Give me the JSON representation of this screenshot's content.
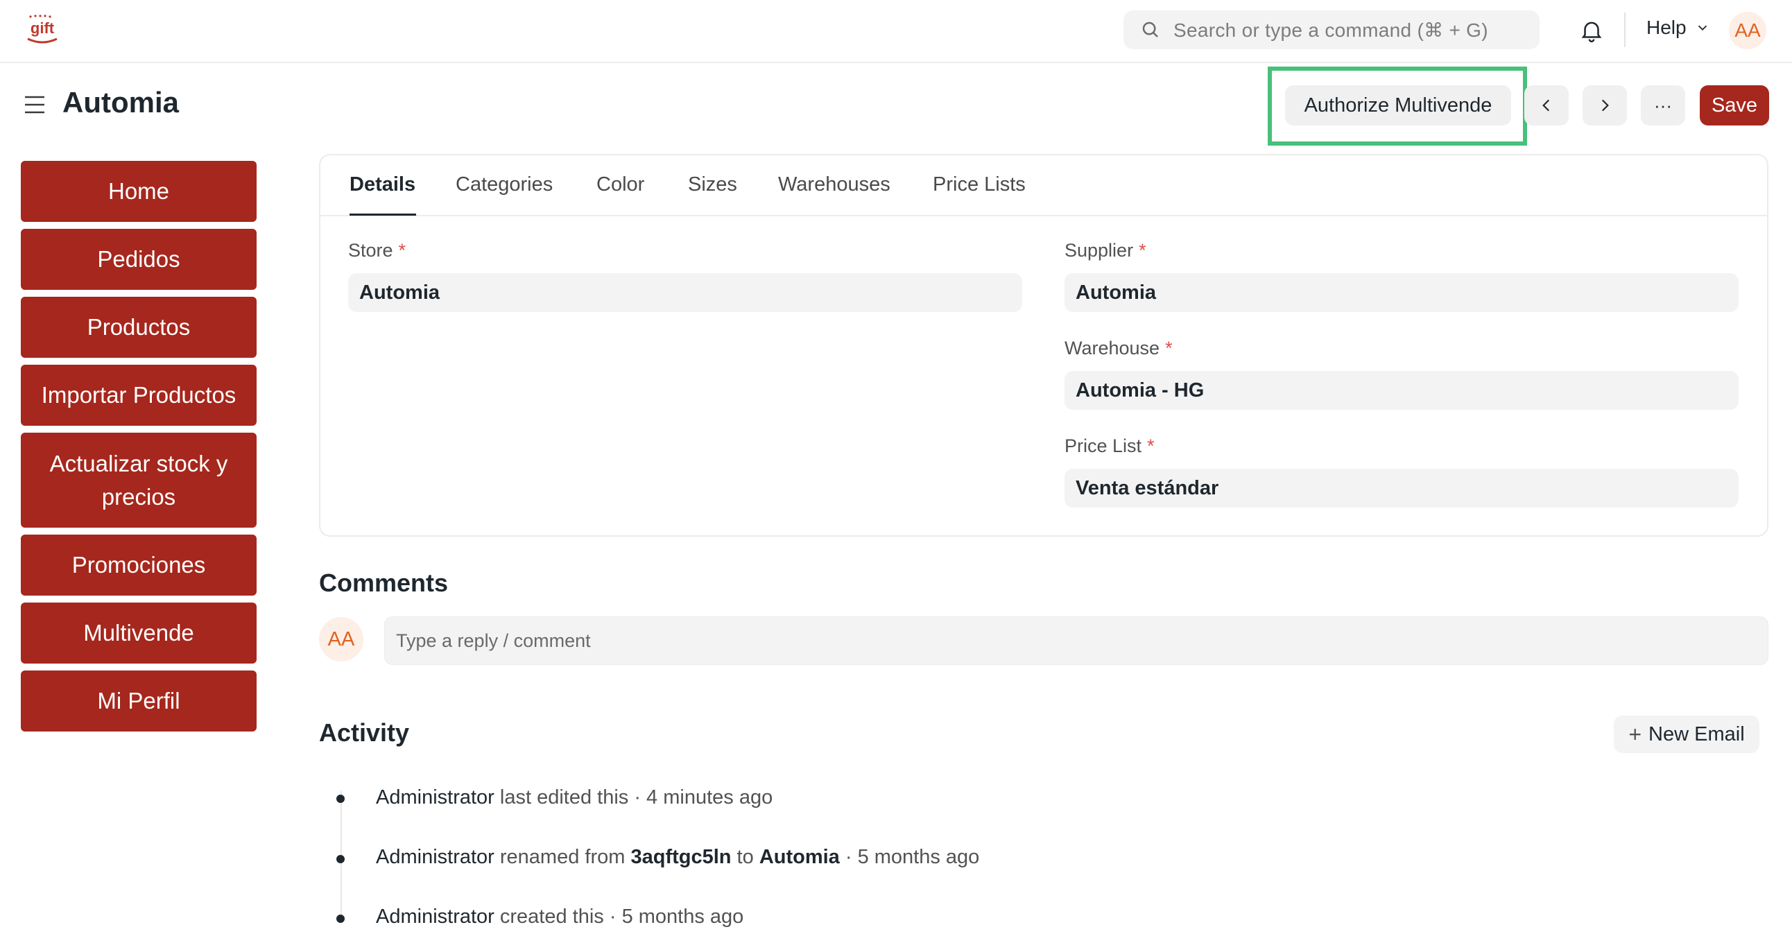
{
  "navbar": {
    "search_placeholder": "Search or type a command (⌘ + G)",
    "help_label": "Help",
    "avatar_initials": "AA"
  },
  "page": {
    "title": "Automia",
    "authorize_button": "Authorize Multivende",
    "more_button": "···",
    "save_button": "Save"
  },
  "sidebar": {
    "items": [
      {
        "label": "Home"
      },
      {
        "label": "Pedidos"
      },
      {
        "label": "Productos"
      },
      {
        "label": "Importar Productos"
      },
      {
        "label": "Actualizar stock y precios"
      },
      {
        "label": "Promociones"
      },
      {
        "label": "Multivende"
      },
      {
        "label": "Mi Perfil"
      }
    ]
  },
  "tabs": [
    {
      "label": "Details"
    },
    {
      "label": "Categories"
    },
    {
      "label": "Color"
    },
    {
      "label": "Sizes"
    },
    {
      "label": "Warehouses"
    },
    {
      "label": "Price Lists"
    }
  ],
  "form": {
    "store": {
      "label": "Store",
      "value": "Automia"
    },
    "supplier": {
      "label": "Supplier",
      "value": "Automia"
    },
    "warehouse": {
      "label": "Warehouse",
      "value": "Automia - HG"
    },
    "price_list": {
      "label": "Price List",
      "value": "Venta estándar"
    },
    "required_mark": "*"
  },
  "comments": {
    "title": "Comments",
    "avatar_initials": "AA",
    "placeholder": "Type a reply / comment"
  },
  "activity": {
    "title": "Activity",
    "new_email": "New Email",
    "items": [
      {
        "who": "Administrator",
        "text": " last edited this · 4 minutes ago"
      },
      {
        "who": "Administrator",
        "pre": " renamed from ",
        "from": "3aqftgc5ln",
        "mid": " to ",
        "to": "Automia",
        "post": " · 5 months ago"
      },
      {
        "who": "Administrator",
        "text": " created this · 5 months ago"
      }
    ]
  },
  "colors": {
    "brand_red": "#a6271d",
    "highlight_green": "#47c07a",
    "avatar_orange": "#e0621f"
  }
}
